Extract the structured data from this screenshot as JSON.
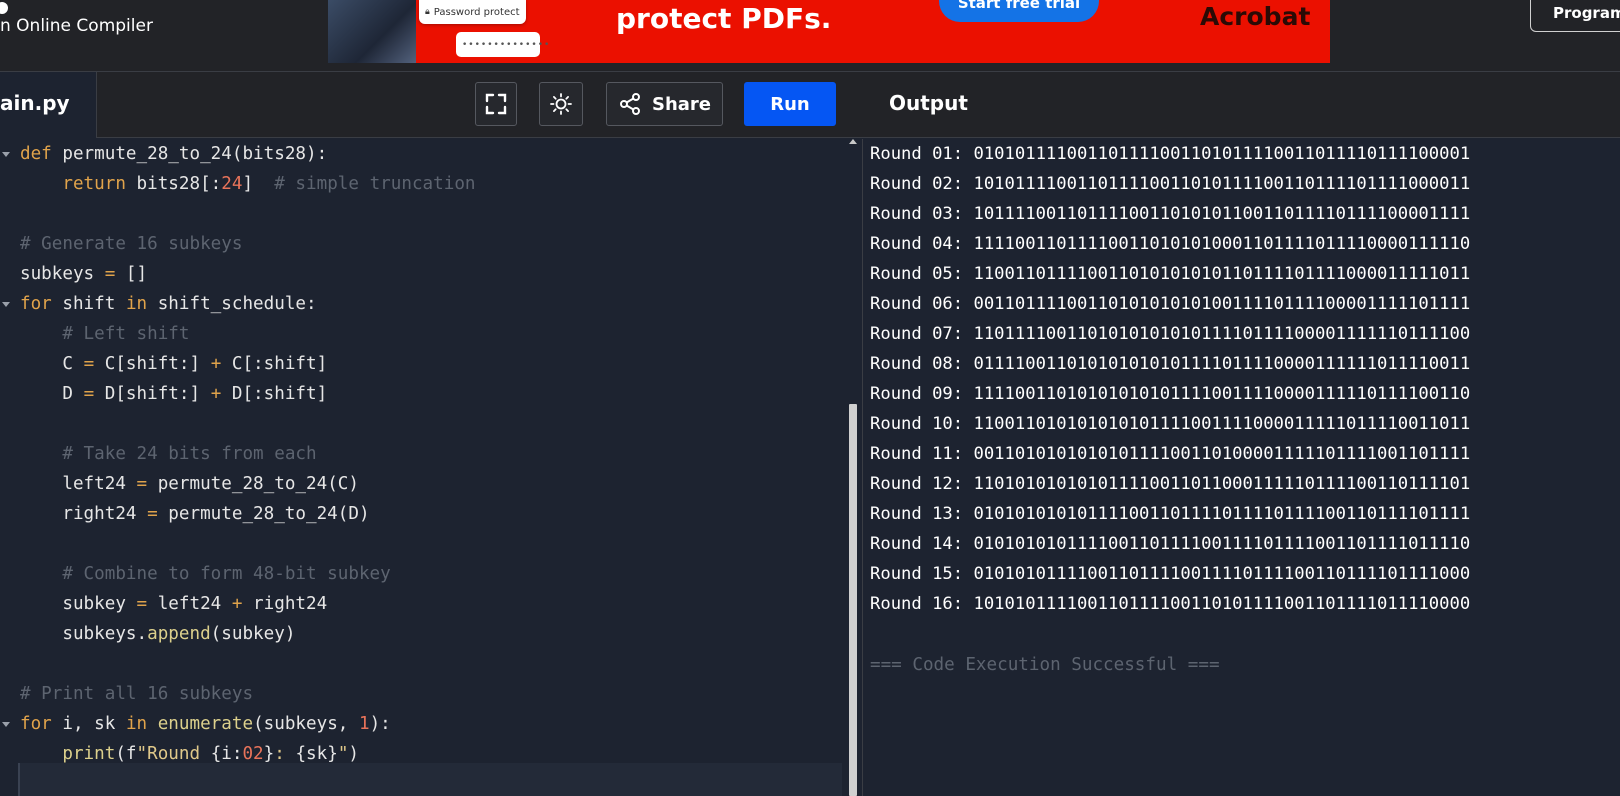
{
  "topbar": {
    "brand_text": "n Online Compiler",
    "programiz_button_label": "Program",
    "ad": {
      "password_card_label": "Password protect",
      "password_field_mask": "••••••••••••••",
      "headline": "protect PDFs.",
      "cta_label": "Start free trial",
      "brand_logo_text": "Acrobat",
      "background_color": "#eb1000"
    }
  },
  "toolbar": {
    "file_tab_label": "ain.py",
    "fullscreen_icon": "fullscreen-icon",
    "theme_icon": "sun-icon",
    "share_label": "Share",
    "share_icon": "share-icon",
    "run_label": "Run",
    "run_color": "#0556f3",
    "output_title": "Output"
  },
  "editor": {
    "lines": [
      {
        "fold": true,
        "tokens": [
          {
            "t": "def",
            "c": "kw"
          },
          {
            "t": " permute_28_to_24(bits28):",
            "c": ""
          }
        ]
      },
      {
        "fold": false,
        "tokens": [
          {
            "t": "    ",
            "c": ""
          },
          {
            "t": "return",
            "c": "kw"
          },
          {
            "t": " bits28[:",
            "c": ""
          },
          {
            "t": "24",
            "c": "num"
          },
          {
            "t": "]  ",
            "c": ""
          },
          {
            "t": "# simple truncation",
            "c": "cmt"
          }
        ]
      },
      {
        "fold": false,
        "tokens": []
      },
      {
        "fold": false,
        "tokens": [
          {
            "t": "# Generate 16 subkeys",
            "c": "cmt"
          }
        ]
      },
      {
        "fold": false,
        "tokens": [
          {
            "t": "subkeys ",
            "c": ""
          },
          {
            "t": "=",
            "c": "op"
          },
          {
            "t": " []",
            "c": ""
          }
        ]
      },
      {
        "fold": true,
        "tokens": [
          {
            "t": "for",
            "c": "kw"
          },
          {
            "t": " shift ",
            "c": ""
          },
          {
            "t": "in",
            "c": "kw"
          },
          {
            "t": " shift_schedule:",
            "c": ""
          }
        ]
      },
      {
        "fold": false,
        "tokens": [
          {
            "t": "    ",
            "c": ""
          },
          {
            "t": "# Left shift",
            "c": "cmt"
          }
        ]
      },
      {
        "fold": false,
        "tokens": [
          {
            "t": "    C ",
            "c": ""
          },
          {
            "t": "=",
            "c": "op"
          },
          {
            "t": " C[shift:] ",
            "c": ""
          },
          {
            "t": "+",
            "c": "op"
          },
          {
            "t": " C[:shift]",
            "c": ""
          }
        ]
      },
      {
        "fold": false,
        "tokens": [
          {
            "t": "    D ",
            "c": ""
          },
          {
            "t": "=",
            "c": "op"
          },
          {
            "t": " D[shift:] ",
            "c": ""
          },
          {
            "t": "+",
            "c": "op"
          },
          {
            "t": " D[:shift]",
            "c": ""
          }
        ]
      },
      {
        "fold": false,
        "tokens": []
      },
      {
        "fold": false,
        "tokens": [
          {
            "t": "    ",
            "c": ""
          },
          {
            "t": "# Take 24 bits from each",
            "c": "cmt"
          }
        ]
      },
      {
        "fold": false,
        "tokens": [
          {
            "t": "    left24 ",
            "c": ""
          },
          {
            "t": "=",
            "c": "op"
          },
          {
            "t": " permute_28_to_24(C)",
            "c": ""
          }
        ]
      },
      {
        "fold": false,
        "tokens": [
          {
            "t": "    right24 ",
            "c": ""
          },
          {
            "t": "=",
            "c": "op"
          },
          {
            "t": " permute_28_to_24(D)",
            "c": ""
          }
        ]
      },
      {
        "fold": false,
        "tokens": []
      },
      {
        "fold": false,
        "tokens": [
          {
            "t": "    ",
            "c": ""
          },
          {
            "t": "# Combine to form 48-bit subkey",
            "c": "cmt"
          }
        ]
      },
      {
        "fold": false,
        "tokens": [
          {
            "t": "    subkey ",
            "c": ""
          },
          {
            "t": "=",
            "c": "op"
          },
          {
            "t": " left24 ",
            "c": ""
          },
          {
            "t": "+",
            "c": "op"
          },
          {
            "t": " right24",
            "c": ""
          }
        ]
      },
      {
        "fold": false,
        "tokens": [
          {
            "t": "    subkeys.",
            "c": ""
          },
          {
            "t": "append",
            "c": "fn"
          },
          {
            "t": "(subkey)",
            "c": ""
          }
        ]
      },
      {
        "fold": false,
        "tokens": []
      },
      {
        "fold": false,
        "tokens": [
          {
            "t": "# Print all 16 subkeys",
            "c": "cmt"
          }
        ]
      },
      {
        "fold": true,
        "tokens": [
          {
            "t": "for",
            "c": "kw"
          },
          {
            "t": " i, sk ",
            "c": ""
          },
          {
            "t": "in",
            "c": "kw"
          },
          {
            "t": " ",
            "c": ""
          },
          {
            "t": "enumerate",
            "c": "fn"
          },
          {
            "t": "(subkeys, ",
            "c": ""
          },
          {
            "t": "1",
            "c": "num"
          },
          {
            "t": "):",
            "c": ""
          }
        ]
      },
      {
        "fold": false,
        "tokens": [
          {
            "t": "    ",
            "c": ""
          },
          {
            "t": "print",
            "c": "fn"
          },
          {
            "t": "(f",
            "c": ""
          },
          {
            "t": "\"Round ",
            "c": "str"
          },
          {
            "t": "{i:",
            "c": ""
          },
          {
            "t": "02",
            "c": "num"
          },
          {
            "t": "}",
            "c": ""
          },
          {
            "t": ": ",
            "c": "str"
          },
          {
            "t": "{sk}",
            "c": ""
          },
          {
            "t": "\"",
            "c": "str"
          },
          {
            "t": ")",
            "c": ""
          }
        ]
      }
    ]
  },
  "output": {
    "lines": [
      "Round 01: 010101111001101111001101011110011011110111100001",
      "Round 02: 101011110011011110011010111100110111101111000011",
      "Round 03: 101111001101111001101010110011011110111100001111",
      "Round 04: 111100110111100110101010001101111011110000111110",
      "Round 05: 110011011110011010101010110111101111000011111011",
      "Round 06: 001101111001101010101010011110111100001111101111",
      "Round 07: 110111100110101010101011110111100001111110111100",
      "Round 08: 011110011010101010101111011110000111111011110011",
      "Round 09: 111100110101010101011110011110000111110111100110",
      "Round 10: 110011010101010101111001111000011111011110011011",
      "Round 11: 001101010101010111100110100001111101111001101111",
      "Round 12: 110101010101011110011011000111110111100110111101",
      "Round 13: 010101010101111001101111011110111100110111101111",
      "Round 14: 010101010111100110111100111101111001101111011110",
      "Round 15: 010101011110011011110011110111100110111101111000",
      "Round 16: 101010111100110111100110101111001101111011110000"
    ],
    "status": "=== Code Execution Successful ==="
  }
}
